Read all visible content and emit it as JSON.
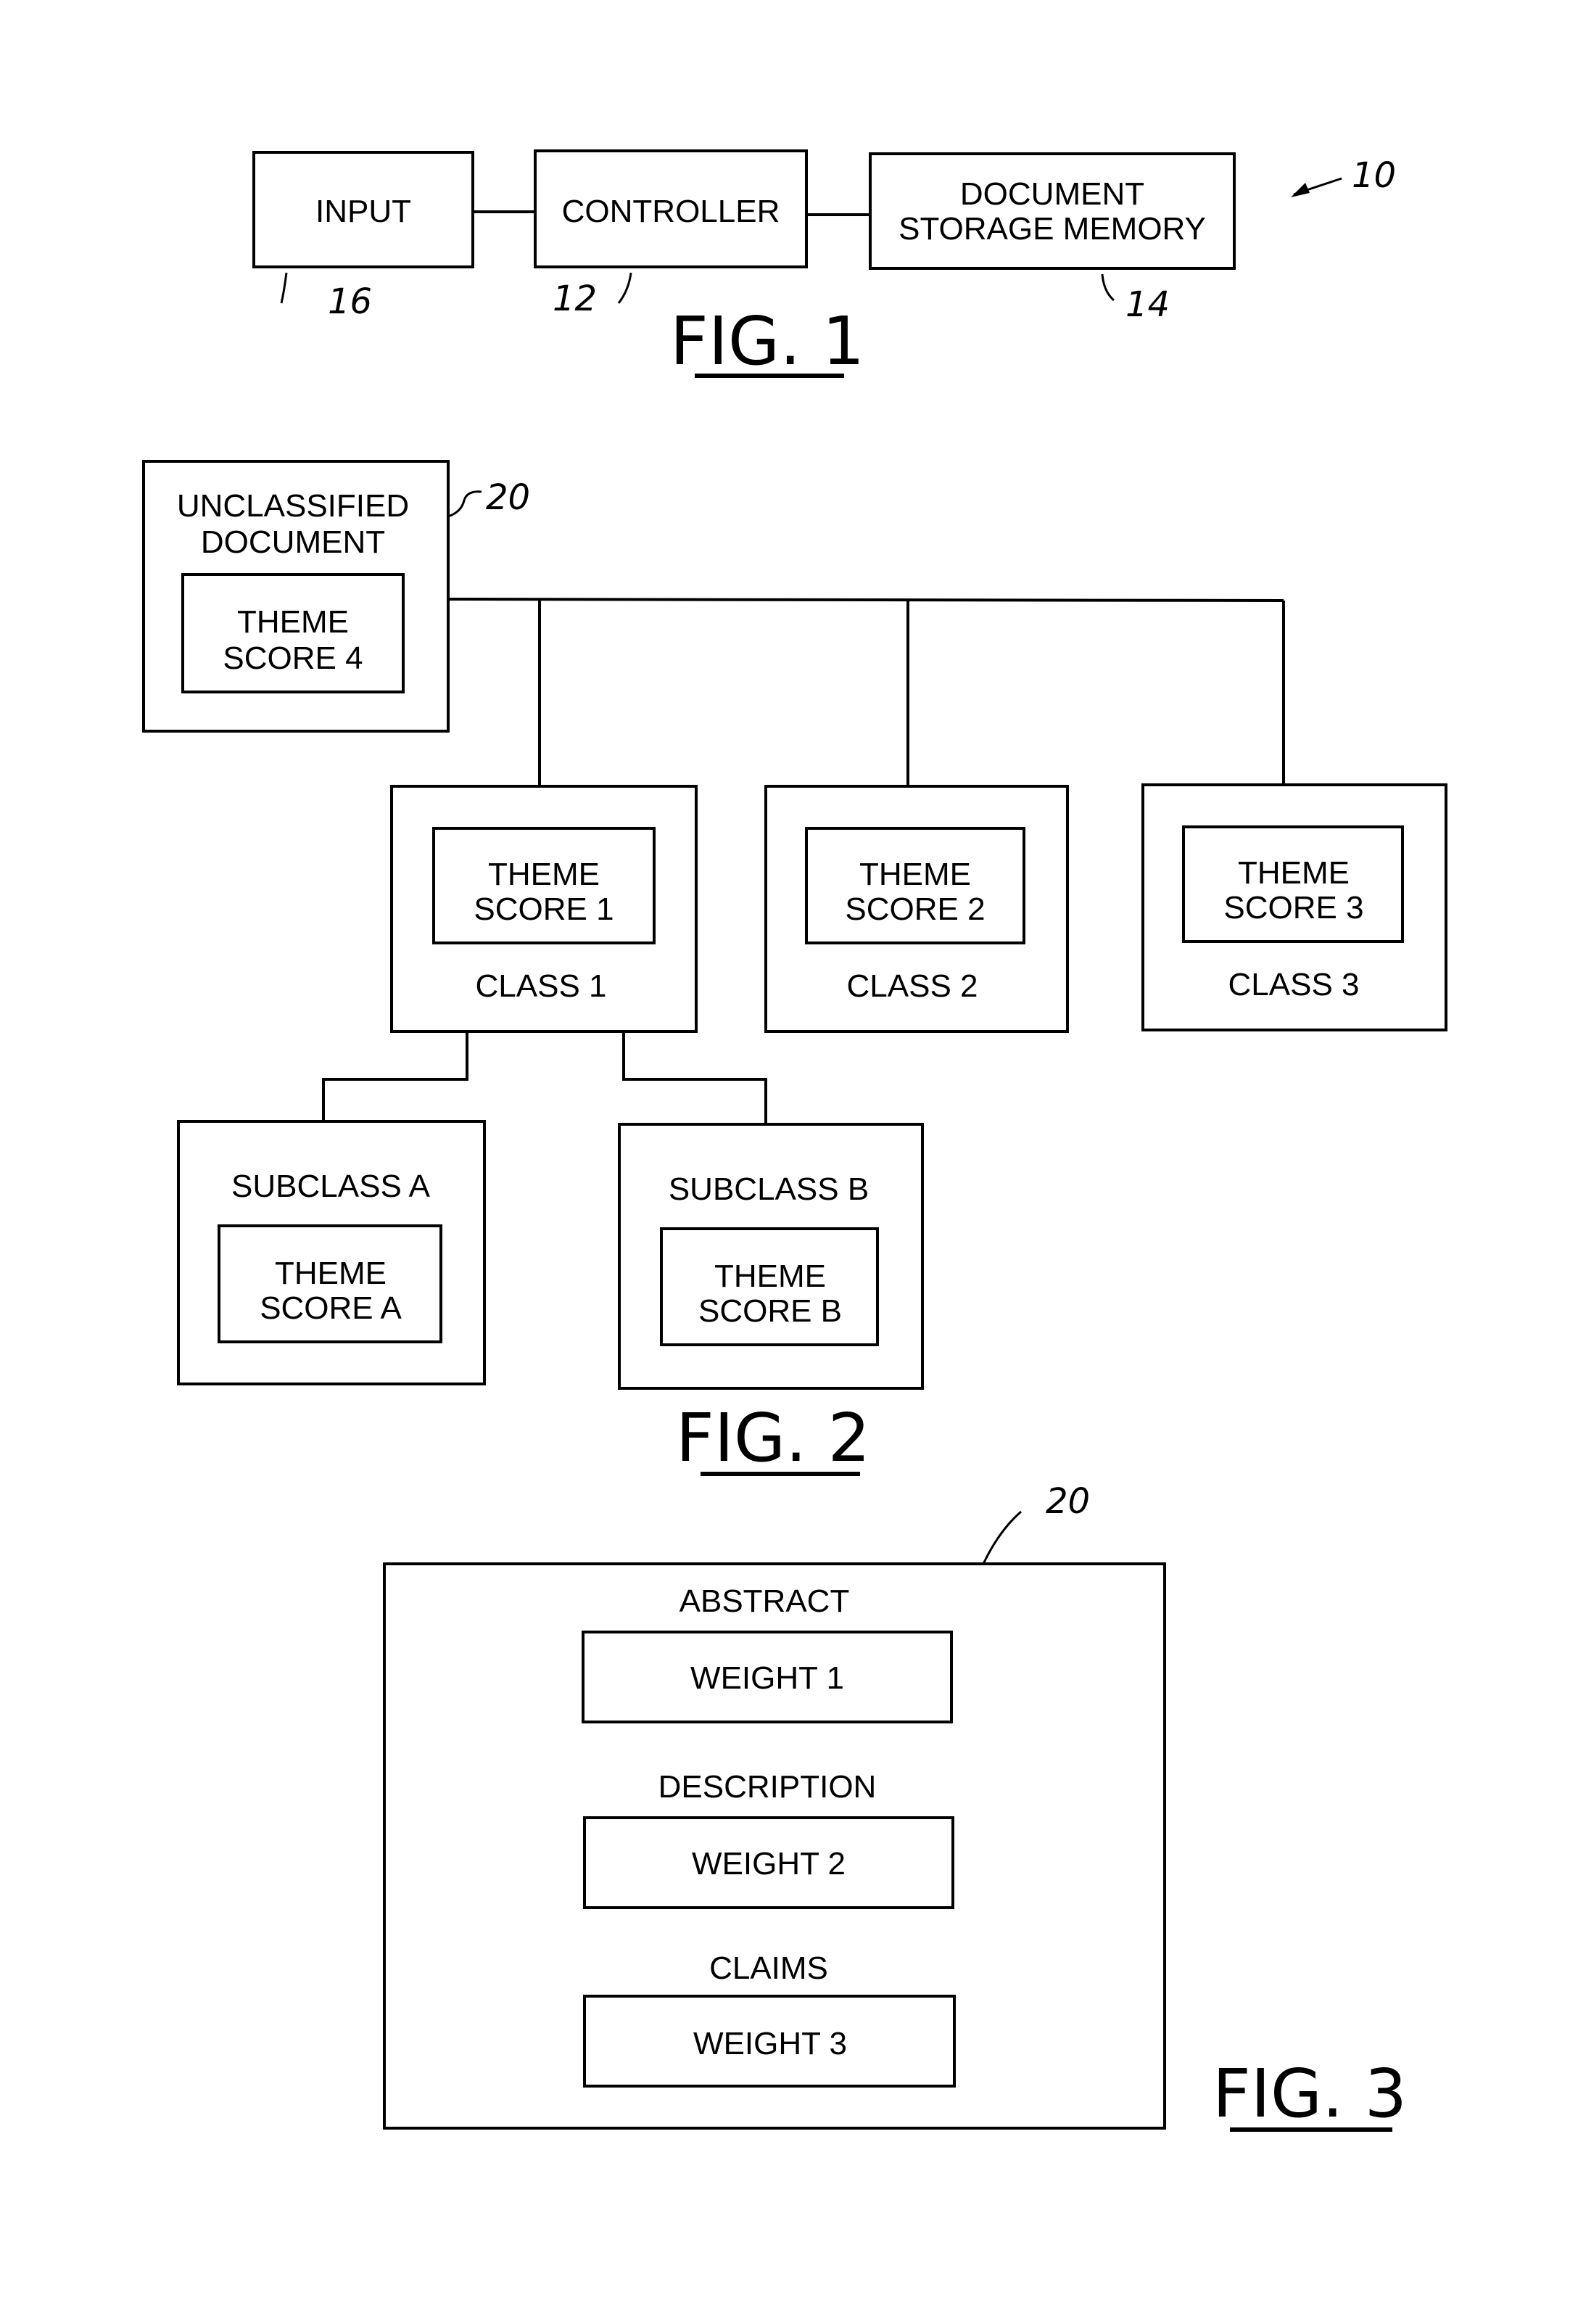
{
  "fig1": {
    "caption": "FIG. 1",
    "system_ref": "10",
    "input": {
      "label": "INPUT",
      "ref": "16"
    },
    "controller": {
      "label": "CONTROLLER",
      "ref": "12"
    },
    "memory": {
      "line1": "DOCUMENT",
      "line2": "STORAGE MEMORY",
      "ref": "14"
    }
  },
  "fig2": {
    "caption": "FIG. 2",
    "unclassified": {
      "line1": "UNCLASSIFIED",
      "line2": "DOCUMENT",
      "ref": "20",
      "score_line1": "THEME",
      "score_line2": "SCORE 4"
    },
    "classes": [
      {
        "label": "CLASS 1",
        "score_line1": "THEME",
        "score_line2": "SCORE 1"
      },
      {
        "label": "CLASS 2",
        "score_line1": "THEME",
        "score_line2": "SCORE 2"
      },
      {
        "label": "CLASS 3",
        "score_line1": "THEME",
        "score_line2": "SCORE 3"
      }
    ],
    "subclasses": [
      {
        "label": "SUBCLASS A",
        "score_line1": "THEME",
        "score_line2": "SCORE A"
      },
      {
        "label": "SUBCLASS B",
        "score_line1": "THEME",
        "score_line2": "SCORE B"
      }
    ]
  },
  "fig3": {
    "caption": "FIG. 3",
    "ref": "20",
    "sections": [
      {
        "heading": "ABSTRACT",
        "weight": "WEIGHT 1"
      },
      {
        "heading": "DESCRIPTION",
        "weight": "WEIGHT 2"
      },
      {
        "heading": "CLAIMS",
        "weight": "WEIGHT 3"
      }
    ]
  }
}
